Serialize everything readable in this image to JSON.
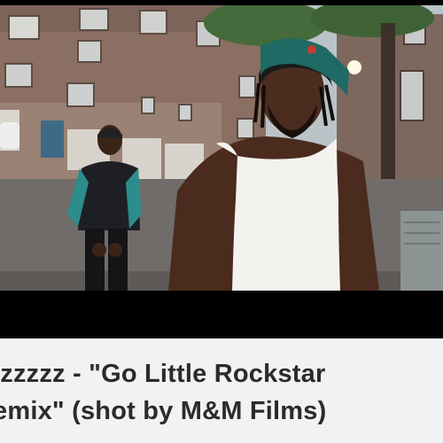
{
  "video": {
    "title_line_1": "izzzzz - \"Go Little Rockstar",
    "title_line_2": "emix\" (shot by M&M Films)"
  },
  "colors": {
    "letterbox": "#000000",
    "title_background": "#f2f2f4",
    "title_text": "#2b2b2e"
  }
}
